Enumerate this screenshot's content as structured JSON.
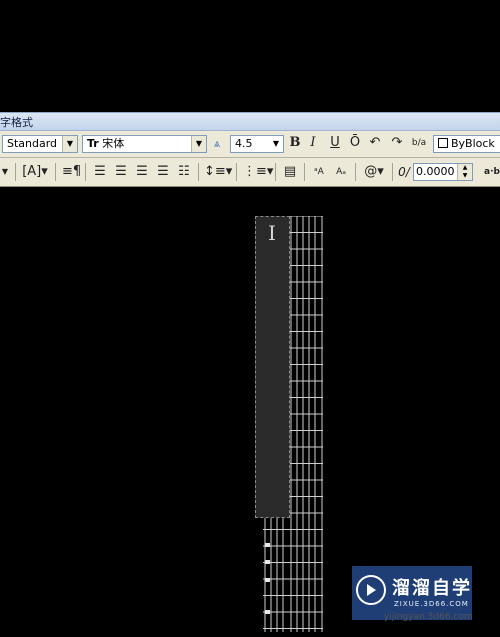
{
  "window": {
    "title": "字格式"
  },
  "toolbar1": {
    "style_value": "Standard",
    "font_prefix": "Tr",
    "font_value": "宋体",
    "height_value": "4.5",
    "bold": "B",
    "italic": "I",
    "underline": "U",
    "overline": "Ō",
    "undo": "↶",
    "redo": "↷",
    "stack": "b/a",
    "color_value": "ByBlock"
  },
  "toolbar2": {
    "oblique_label": "0/",
    "oblique_value": "0.0000",
    "tracking_label": "a·b"
  },
  "watermark": {
    "title": "溜溜自学",
    "subtitle": "ZIXUE.3D66.COM",
    "under": "yijingyan.3d66.com"
  }
}
